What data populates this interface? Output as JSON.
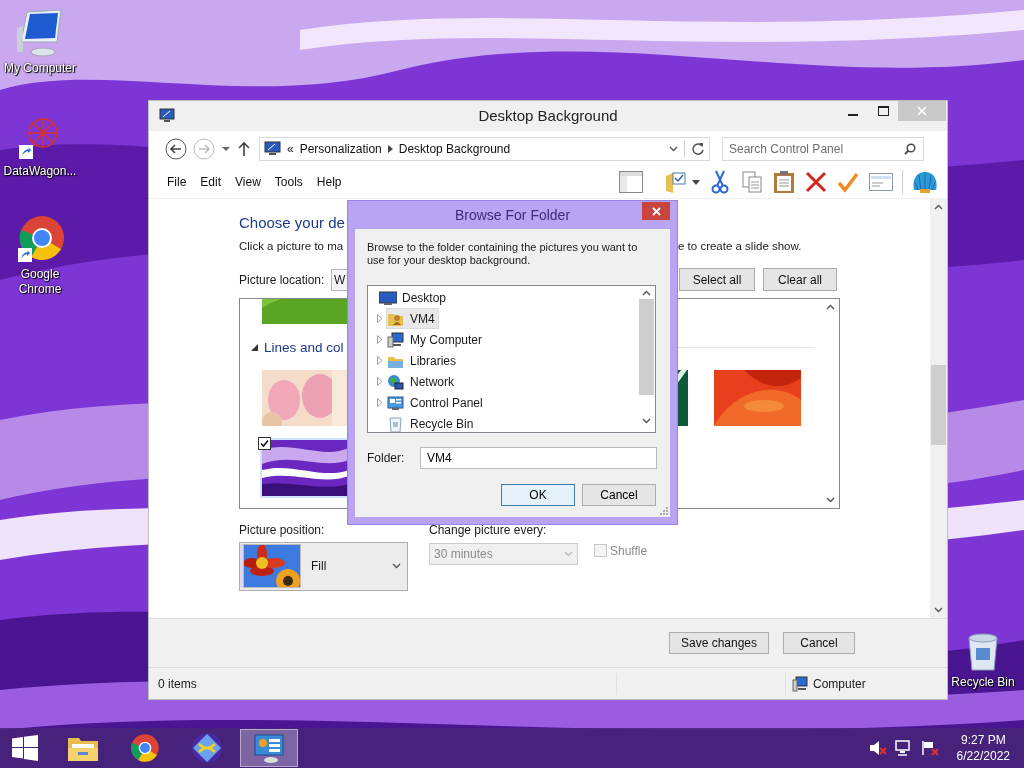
{
  "desktop_icons": [
    {
      "label": "My Computer"
    },
    {
      "label": "DataWagon..."
    },
    {
      "label": "Google Chrome"
    }
  ],
  "recycle_bin": {
    "label": "Recycle Bin"
  },
  "window": {
    "title": "Desktop Background",
    "address": {
      "overflow_mark": "«",
      "crumbs": [
        "Personalization",
        "Desktop Background"
      ]
    },
    "search": {
      "placeholder": "Search Control Panel"
    },
    "menu": [
      "File",
      "Edit",
      "View",
      "Tools",
      "Help"
    ],
    "heading": "Choose your de",
    "instruction_left": "Click a picture to ma",
    "instruction_right": "e to create a slide show.",
    "location_label": "Picture location:",
    "location_value": "W",
    "list_buttons": [
      "Select all",
      "Clear all"
    ],
    "picture_list": {
      "partial_top": {
        "kind": "picture"
      },
      "group": {
        "title": "Lines and col",
        "expanded": true
      },
      "rows": [
        {
          "pictures": [
            {
              "kind": "picture",
              "checked": false
            },
            {
              "kind": "picture",
              "checked": false
            },
            {
              "kind": "picture",
              "checked": false
            }
          ]
        },
        {
          "pictures": [
            {
              "kind": "picture",
              "checked": true
            }
          ]
        }
      ]
    },
    "position_label": "Picture position:",
    "position_value": "Fill",
    "interval_label": "Change picture every:",
    "interval_value": "30 minutes",
    "interval_disabled": true,
    "shuffle": {
      "label": "Shuffle",
      "checked": false,
      "disabled": true
    },
    "footer_buttons": [
      "Save changes",
      "Cancel"
    ],
    "status": {
      "items": "0 items",
      "zone": "Computer"
    }
  },
  "dialog": {
    "title": "Browse For Folder",
    "description": "Browse to the folder containing the pictures you want to use for your desktop background.",
    "tree": [
      {
        "label": "Desktop",
        "expandable": false,
        "selected": false,
        "children": [
          {
            "label": "VM4",
            "expandable": true,
            "selected": true
          },
          {
            "label": "My Computer",
            "expandable": true,
            "selected": false
          },
          {
            "label": "Libraries",
            "expandable": true,
            "selected": false
          },
          {
            "label": "Network",
            "expandable": true,
            "selected": false
          },
          {
            "label": "Control Panel",
            "expandable": true,
            "selected": false
          },
          {
            "label": "Recycle Bin",
            "expandable": false,
            "selected": false
          }
        ]
      }
    ],
    "folder_label": "Folder:",
    "folder_value": "VM4",
    "buttons": [
      {
        "label": "OK",
        "default": true
      },
      {
        "label": "Cancel",
        "default": false
      }
    ]
  },
  "taskbar": {
    "apps": [
      {
        "selected": false
      },
      {
        "selected": false
      },
      {
        "selected": false
      },
      {
        "selected": true
      }
    ],
    "clock": {
      "time": "9:27 PM",
      "date": "6/22/2022"
    }
  }
}
